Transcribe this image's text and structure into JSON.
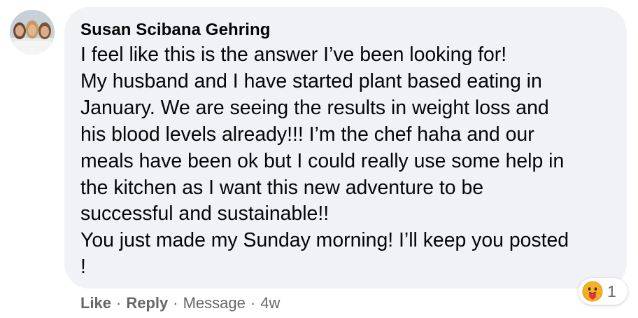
{
  "comment": {
    "author": "Susan Scibana Gehring",
    "lines": [
      "I feel like this is the answer I’ve been looking for!",
      "My husband and I have started plant based eating in",
      "January. We are seeing the results in weight loss and",
      "his blood levels already!!! I’m the chef haha and our",
      "meals have been ok but I could really use some help in",
      "the kitchen as I want this new adventure to be",
      "successful and sustainable!!",
      "You just made my Sunday morning! I’ll keep you posted",
      "!"
    ]
  },
  "reaction": {
    "icon": "care-reaction-icon",
    "count": "1"
  },
  "actions": {
    "like": "Like",
    "reply": "Reply",
    "message": "Message",
    "time": "4w",
    "separator": "·"
  }
}
